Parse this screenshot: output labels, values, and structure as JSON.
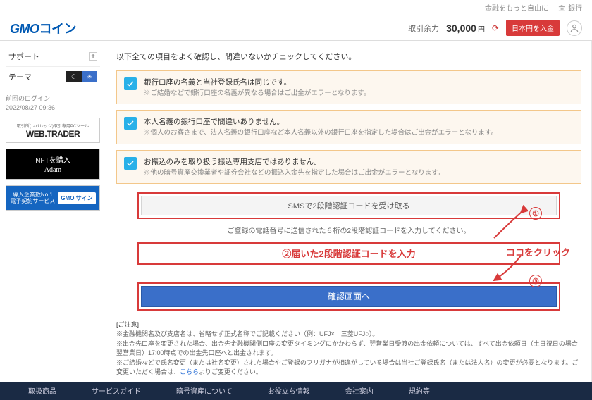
{
  "topbar": {
    "tagline": "金融をもっと自由に",
    "bank": "銀行"
  },
  "header": {
    "logo_gmo": "GMO",
    "logo_coin": "コイン",
    "balance_label": "取引余力",
    "balance_amount": "30,000",
    "balance_unit": "円",
    "deposit_btn": "日本円を入金"
  },
  "sidebar": {
    "support": "サポート",
    "theme": "テーマ",
    "last_login_label": "前回のログイン",
    "last_login_value": "2022/08/27 09:36",
    "webtrader_mini": "取引所(レバレッジ)取引専用PCツール",
    "webtrader": "WEB.TRADER",
    "nft_title": "NFTを購入",
    "nft_adam": "Adam",
    "gmosign_left1": "導入企業数No.1",
    "gmosign_left2": "電子契約サービス",
    "gmosign_right": "GMO\nサイン"
  },
  "main": {
    "intro": "以下全ての項目をよく確認し、間違いないかチェックしてください。",
    "checks": [
      {
        "t1": "銀行口座の名義と当社登録氏名は同じです。",
        "t2": "※ご結婚などで銀行口座の名義が異なる場合はご出金がエラーとなります。"
      },
      {
        "t1": "本人名義の銀行口座で間違いありません。",
        "t2": "※個人のお客さまで、法人名義の銀行口座など本人名義以外の銀行口座を指定した場合はご出金がエラーとなります。"
      },
      {
        "t1": "お振込のみを取り扱う振込専用支店ではありません。",
        "t2": "※他の暗号資産交換業者や証券会社などの振込入金先を指定した場合はご出金がエラーとなります。"
      }
    ],
    "sms_btn": "SMSで2段階認証コードを受け取る",
    "sms_hint": "ご登録の電話番号に送信された６桁の2段階認証コードを入力してください。",
    "code_label": "②届いた2段階認証コードを入力",
    "confirm_btn": "確認画面へ",
    "anno_click": "ココをクリック",
    "anno_1": "①",
    "anno_3": "③",
    "notes_hd": "[ご注意]",
    "notes_1": "※金融機関名及び支店名は、省略せず正式名称でご記載ください（例：UFJ×　三菱UFJ○）。",
    "notes_2": "※出金先口座を変更された場合、出金先金融機関側口座の変更タイミングにかかわらず、翌営業日受渡の出金依頼については、すべて出金依頼日（土日祝日の場合翌営業日）17:00時点での出金先口座へと出金されます。",
    "notes_3_a": "※ご結婚などで氏名変更（または社名変更）された場合やご登録のフリガナが相違がしている場合は当社ご登録氏名（または法人名）の変更が必要となります。ご変更いただく場合は、",
    "notes_3_link": "こちら",
    "notes_3_b": "よりご変更ください。"
  },
  "footer": {
    "items": [
      "取扱商品",
      "サービスガイド",
      "暗号資産について",
      "お役立ち情報",
      "会社案内",
      "規約等"
    ]
  }
}
